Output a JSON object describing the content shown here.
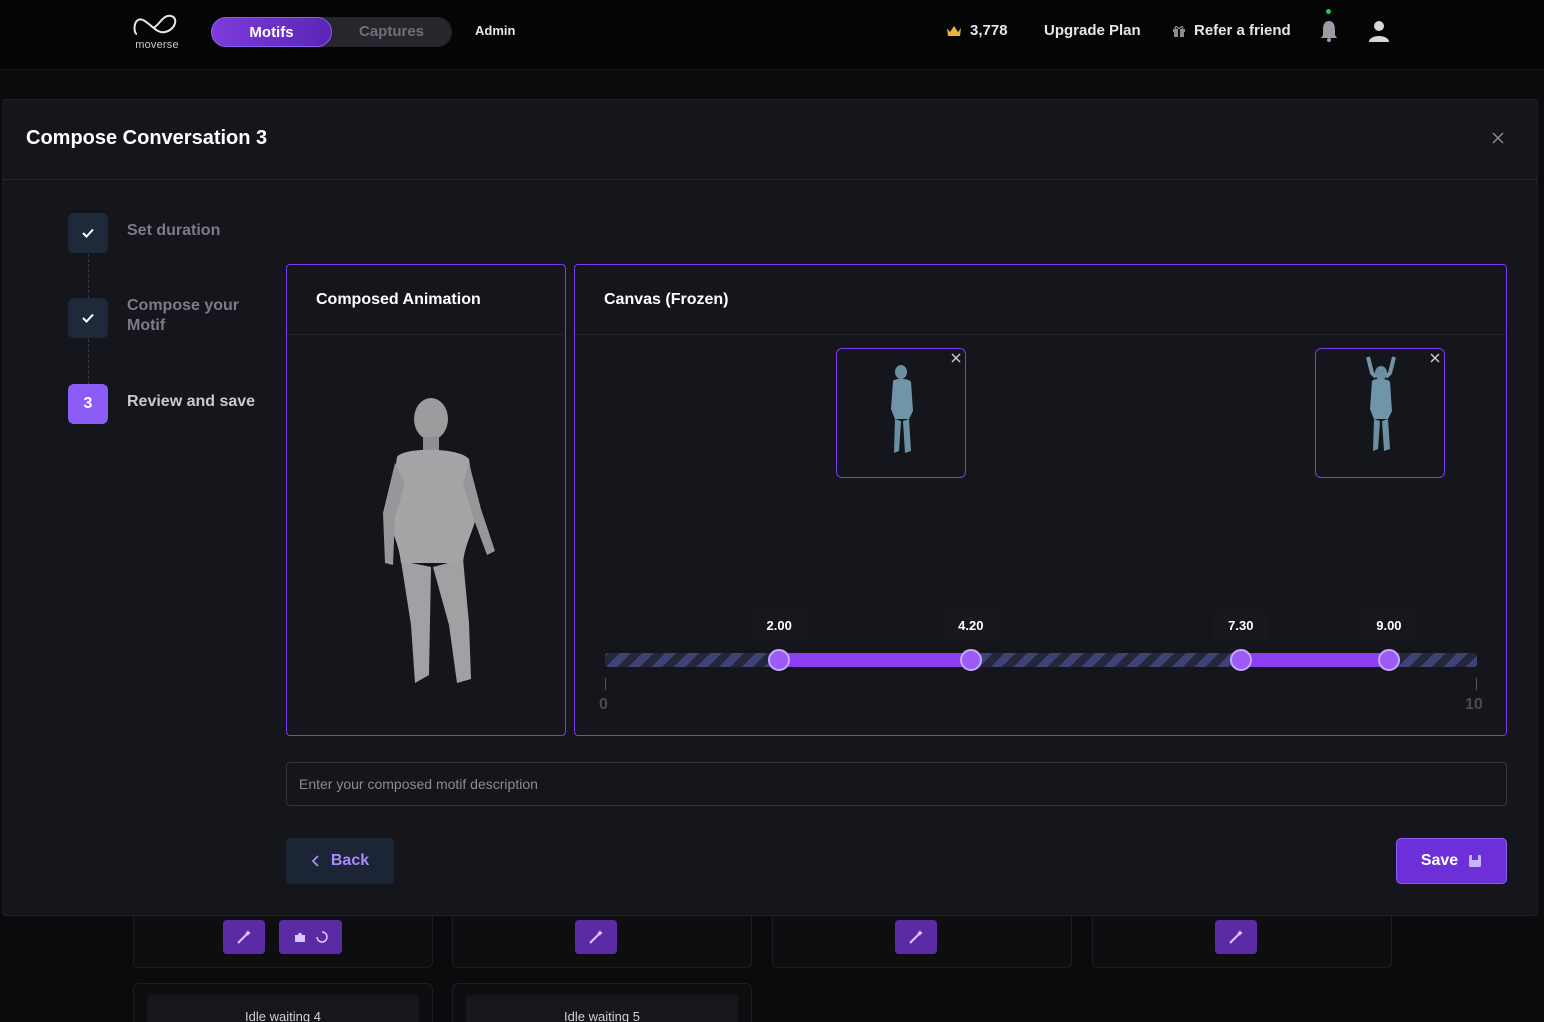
{
  "nav": {
    "logo_text": "moverse",
    "tabs": [
      {
        "label": "Motifs",
        "active": true
      },
      {
        "label": "Captures",
        "active": false
      }
    ],
    "admin_label": "Admin",
    "credits": "3,778",
    "upgrade_label": "Upgrade Plan",
    "refer_label": "Refer a friend"
  },
  "modal": {
    "title": "Compose Conversation 3",
    "steps": [
      {
        "marker": "",
        "label": "Set duration",
        "state": "done"
      },
      {
        "marker": "",
        "label": "Compose your Motif",
        "state": "done"
      },
      {
        "marker": "3",
        "label": "Review and save",
        "state": "current"
      }
    ],
    "composed_title": "Composed Animation",
    "canvas_title": "Canvas (Frozen)",
    "timeline": {
      "min": 0,
      "max": 10,
      "min_label": "0",
      "max_label": "10",
      "markers": [
        {
          "label": "2.00",
          "value": 2.0
        },
        {
          "label": "4.20",
          "value": 4.2
        },
        {
          "label": "7.30",
          "value": 7.3
        },
        {
          "label": "9.00",
          "value": 9.0
        }
      ],
      "segments": [
        [
          2.0,
          4.2
        ],
        [
          7.3,
          9.0
        ]
      ]
    },
    "description_placeholder": "Enter your composed motif description",
    "back_label": "Back",
    "save_label": "Save"
  },
  "background": {
    "titles": [
      "Idle waiting 4",
      "Idle waiting 5"
    ]
  },
  "colors": {
    "accent": "#8b5cf6",
    "panel_border": "#7c3aed",
    "modal_bg": "#15161b"
  }
}
